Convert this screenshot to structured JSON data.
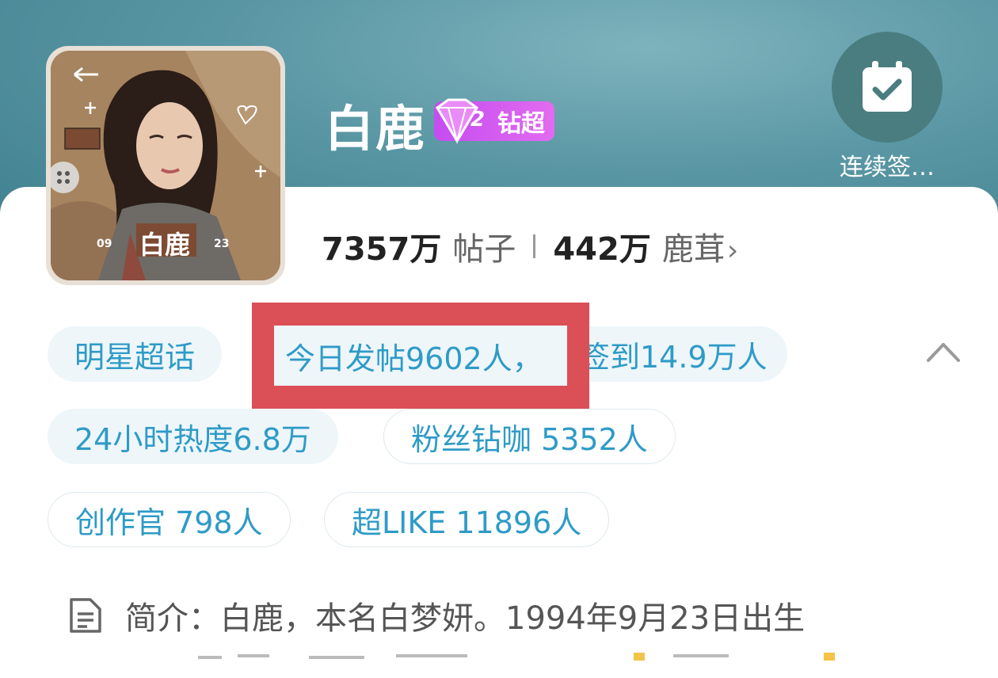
{
  "header": {
    "title": "白鹿",
    "badge_label": "钻超",
    "badge_level": "2",
    "checkin_label": "连续签…",
    "accent_color": "#5a97a4"
  },
  "avatar": {
    "text_name": "白鹿",
    "text_left": "09",
    "text_right": "23"
  },
  "stats": {
    "posts_value": "7357万",
    "posts_label": "帖子",
    "fans_value": "442万",
    "fans_label": "鹿茸"
  },
  "tags": {
    "star": "明星超话",
    "today": "今日发帖9602人，签到14.9万人",
    "today_highlight": "今日发帖9602人，",
    "heat": "24小时热度6.8万",
    "fans": "粉丝钻咖 5352人",
    "creators": "创作官 798人",
    "superlike": "超LIKE 11896人"
  },
  "intro": {
    "label": "简介：白鹿，本名白梦妍。1994年9月23日出生"
  },
  "colors": {
    "chip_text": "#2e9bc7",
    "highlight": "#db4f57",
    "badge": "#c54cf0"
  }
}
